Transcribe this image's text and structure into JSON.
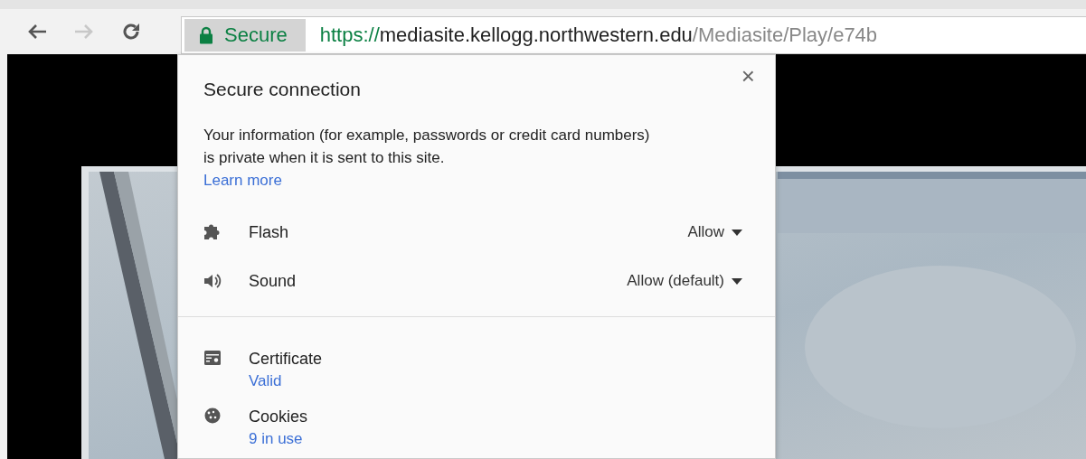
{
  "toolbar": {
    "nav": [
      {
        "kind": "back",
        "disabled": false
      },
      {
        "kind": "forward",
        "disabled": true
      },
      {
        "kind": "reload",
        "disabled": false
      }
    ],
    "security_chip": {
      "label": "Secure"
    },
    "url": {
      "scheme": "https://",
      "host": "mediasite.kellogg.northwestern.edu",
      "path": "/Mediasite/Play/e74b"
    }
  },
  "popup": {
    "title": "Secure connection",
    "close": "×",
    "description": "Your information (for example, passwords or credit card numbers) is private when it is sent to this site.",
    "learn_more": "Learn more",
    "permissions": [
      {
        "kind": "plugin",
        "label": "Flash",
        "value": "Allow"
      },
      {
        "kind": "sound",
        "label": "Sound",
        "value": "Allow (default)"
      }
    ],
    "site_info": [
      {
        "kind": "certificate",
        "label": "Certificate",
        "link": "Valid"
      },
      {
        "kind": "cookies",
        "label": "Cookies",
        "link": "9 in use"
      }
    ]
  }
}
